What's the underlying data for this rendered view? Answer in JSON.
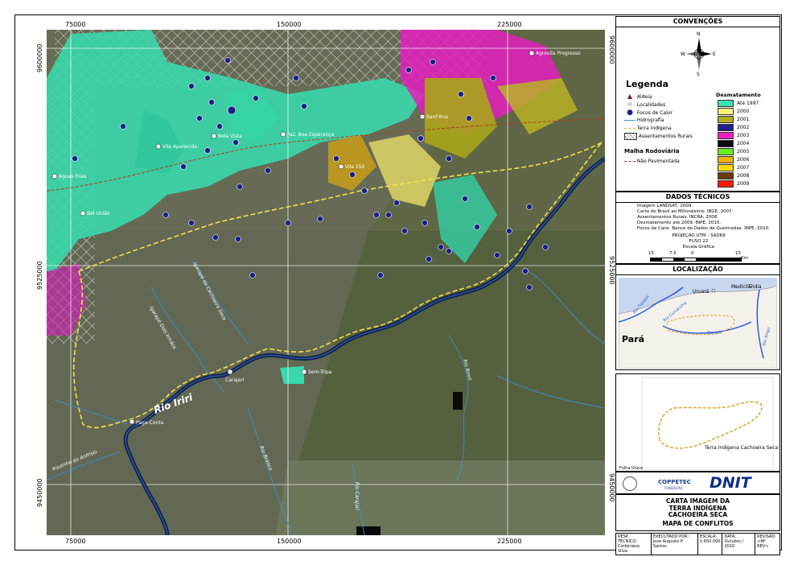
{
  "map": {
    "grid_x_labels": [
      "75000",
      "150000",
      "225000"
    ],
    "grid_y_labels": [
      "9600000",
      "9525000",
      "9450000"
    ],
    "places": [
      {
        "name": "Agrovila Progresso"
      },
      {
        "name": "Sant'Ana"
      },
      {
        "name": "Vila Aparecida"
      },
      {
        "name": "Bela Vista"
      },
      {
        "name": "Faz. Boa Esperança"
      },
      {
        "name": "Vila 150"
      },
      {
        "name": "Aguas Frias"
      },
      {
        "name": "Bel União"
      },
      {
        "name": "Carajari"
      },
      {
        "name": "Sem-Tripa"
      },
      {
        "name": "Paga-Conta"
      }
    ],
    "rivers": [
      {
        "name": "Rio Iriri"
      },
      {
        "name": "Igarapé Dois Irmãos"
      },
      {
        "name": "Igarapé da Cachoeira Seca"
      },
      {
        "name": "Rio Novo"
      },
      {
        "name": "Rio Branco"
      },
      {
        "name": "Riozinho do Anfrísio"
      },
      {
        "name": "Rio Carajari"
      }
    ]
  },
  "panel": {
    "conventions_title": "CONVENÇÕES",
    "north_letters": {
      "n": "N",
      "s": "S",
      "e": "E",
      "w": "W"
    },
    "legend_title": "Legenda",
    "legend_items": [
      {
        "label": "Aldeia",
        "icon": "village-icon"
      },
      {
        "label": "Localidades",
        "icon": "locality-icon"
      },
      {
        "label": "Focos de Calor",
        "icon": "hotspot-icon"
      },
      {
        "label": "Hidrografia",
        "icon": "river-line-icon"
      },
      {
        "label": "Terra Indígena",
        "icon": "indigenous-land-line-icon"
      },
      {
        "label": "Assentamentos Rurais",
        "icon": "settlement-pattern-icon"
      }
    ],
    "roads_title": "Malha Rodoviária",
    "roads_item": "Não Pavimentada",
    "deforest_title": "Desmatamento",
    "deforest_items": [
      {
        "label": "Até 1997",
        "color": "#3de0b0"
      },
      {
        "label": "2000",
        "color": "#f5f27a"
      },
      {
        "label": "2001",
        "color": "#b3ad1a"
      },
      {
        "label": "2002",
        "color": "#1f1f8f"
      },
      {
        "label": "2003",
        "color": "#f020c8"
      },
      {
        "label": "2004",
        "color": "#0a0a0a"
      },
      {
        "label": "2005",
        "color": "#66ee22"
      },
      {
        "label": "2006",
        "color": "#f0b000"
      },
      {
        "label": "2007",
        "color": "#ffd800"
      },
      {
        "label": "2008",
        "color": "#6b3a0c"
      },
      {
        "label": "2009",
        "color": "#ff1a00"
      }
    ],
    "tech_title": "DADOS TÉCNICOS",
    "tech_lines": [
      "Imagem LANDSAT, 2009.",
      "Carta do Brasil ao Milionésimo. IBGE, 2007.",
      "Assentamentos Rurais. INCRA, 2008.",
      "Desmatamento até 2009. INPE, 2010.",
      "Focos de Calor. Banco de Dados de Queimadas. INPE, 2010."
    ],
    "projection": "PROJEÇÃO UTM - SAD69",
    "zone": "FUSO 22",
    "scale_title": "Escala Gráfica",
    "scale_labels": [
      "15",
      "7.5",
      "0",
      "15"
    ],
    "scale_unit": "Km",
    "loc_title": "LOCALIZAÇÃO",
    "loc_labels": {
      "uruara": "Uruará",
      "medicilandia": "Medicilândia",
      "para": "Pará",
      "iriri": "Rio Iriri",
      "curua": "Rio Curuá-Una",
      "xingu": "Rio Xingu",
      "tapajos": "Rio Tapajós"
    },
    "inset_label": "Terra Indígena Cachoeira Seca",
    "inset_sheet": "Folha Única",
    "logos": {
      "coppetec": "COPPETEC",
      "coppetec_sub": "FUNDAÇÃO",
      "dnit": "DNIT"
    },
    "title_lines": [
      "CARTA IMAGEM DA",
      "TERRA INDÍGENA",
      "CACHOEIRA SECA"
    ],
    "subtitle": "MAPA DE CONFLITOS",
    "footer": {
      "headers": [
        "RESP. TÉCNICO:",
        "EXECUTADO POR:",
        "ESCALA:",
        "DATA:",
        "REVISÃO:"
      ],
      "values": [
        "Corbiniano Silva",
        "José Augusto P. Santos",
        "1:650.000",
        "Outubro / 2010",
        "<Nº REV>"
      ]
    }
  }
}
